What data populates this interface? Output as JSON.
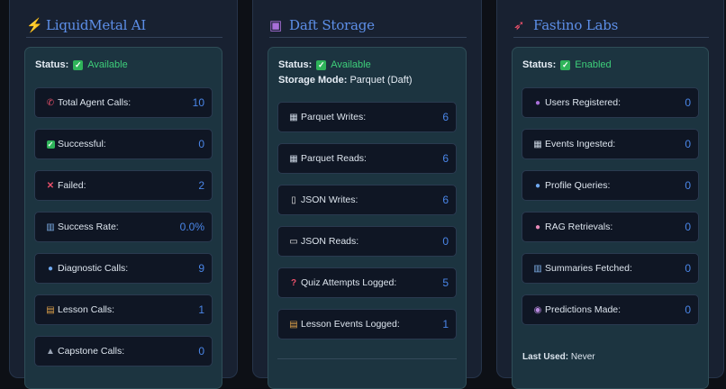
{
  "panels": [
    {
      "title": "LiquidMetal AI",
      "icon": "lightning-icon",
      "status_label": "Status:",
      "status_value": "Available",
      "rows": [
        {
          "icon": "phone-icon",
          "label": "Total Agent Calls:",
          "value": "10"
        },
        {
          "icon": "check-icon",
          "label": "Successful:",
          "value": "0"
        },
        {
          "icon": "cross-icon",
          "label": "Failed:",
          "value": "2"
        },
        {
          "icon": "bar-chart-icon",
          "label": "Success Rate:",
          "value": "0.0%"
        },
        {
          "icon": "magnifier-icon",
          "label": "Diagnostic Calls:",
          "value": "9"
        },
        {
          "icon": "books-icon",
          "label": "Lesson Calls:",
          "value": "1"
        },
        {
          "icon": "graduation-cap-icon",
          "label": "Capstone Calls:",
          "value": "0"
        }
      ]
    },
    {
      "title": "Daft Storage",
      "icon": "floppy-disk-icon",
      "status_label": "Status:",
      "status_value": "Available",
      "mode_label": "Storage Mode:",
      "mode_value": "Parquet (Daft)",
      "rows": [
        {
          "icon": "calendar-icon",
          "label": "Parquet Writes:",
          "value": "6"
        },
        {
          "icon": "calendar-icon",
          "label": "Parquet Reads:",
          "value": "6"
        },
        {
          "icon": "document-icon",
          "label": "JSON Writes:",
          "value": "6"
        },
        {
          "icon": "open-book-icon",
          "label": "JSON Reads:",
          "value": "0"
        },
        {
          "icon": "question-icon",
          "label": "Quiz Attempts Logged:",
          "value": "5"
        },
        {
          "icon": "books-icon",
          "label": "Lesson Events Logged:",
          "value": "1"
        }
      ]
    },
    {
      "title": "Fastino Labs",
      "icon": "rocket-icon",
      "status_label": "Status:",
      "status_value": "Enabled",
      "rows": [
        {
          "icon": "user-icon",
          "label": "Users Registered:",
          "value": "0"
        },
        {
          "icon": "calendar-icon",
          "label": "Events Ingested:",
          "value": "0"
        },
        {
          "icon": "magnifier-icon",
          "label": "Profile Queries:",
          "value": "0"
        },
        {
          "icon": "brain-icon",
          "label": "RAG Retrievals:",
          "value": "0"
        },
        {
          "icon": "bar-chart-icon",
          "label": "Summaries Fetched:",
          "value": "0"
        },
        {
          "icon": "crystal-ball-icon",
          "label": "Predictions Made:",
          "value": "0"
        }
      ],
      "last_used_label": "Last Used:",
      "last_used_value": "Never"
    }
  ]
}
